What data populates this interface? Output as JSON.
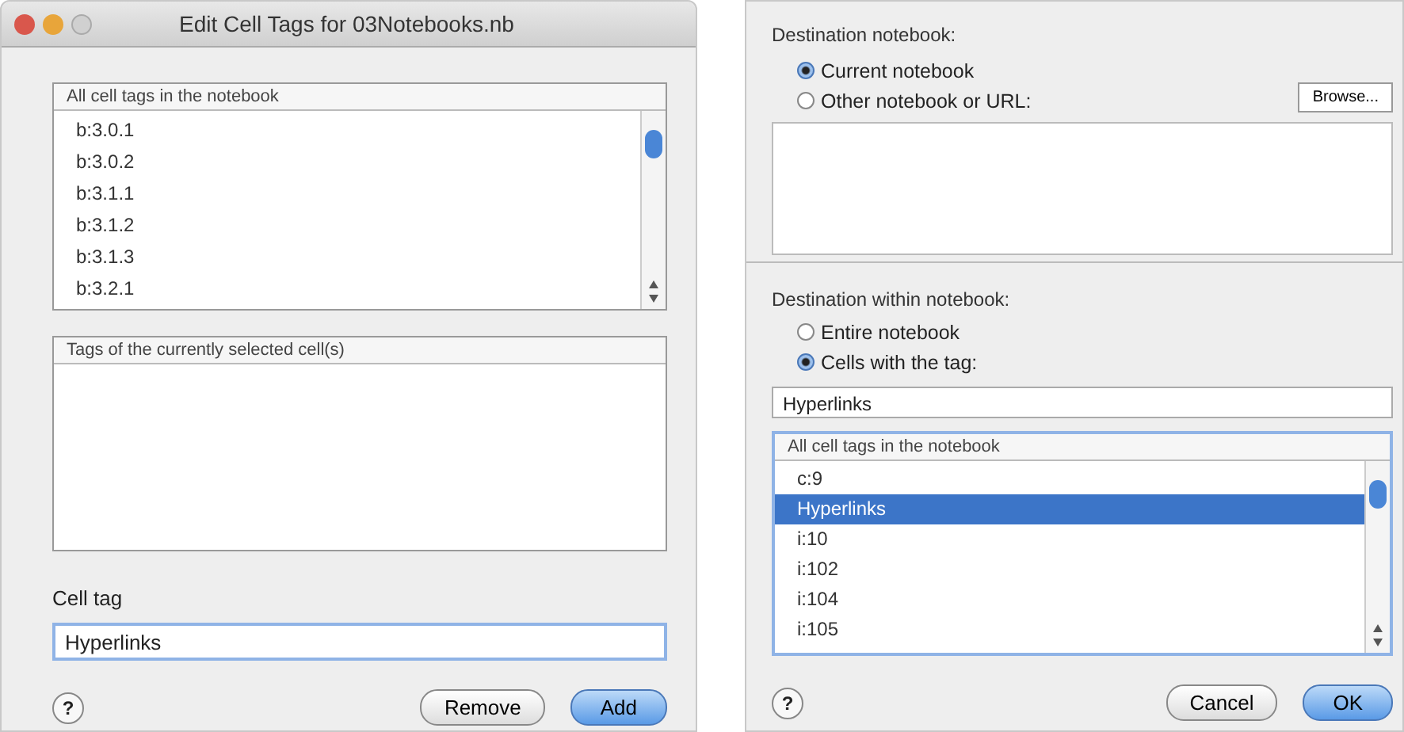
{
  "left_dialog": {
    "window": {
      "title": "Edit Cell Tags for 03Notebooks.nb"
    },
    "all_tags": {
      "header": "All cell tags in the notebook",
      "rows": [
        {
          "label": "b:3.0.1",
          "selected": false
        },
        {
          "label": "b:3.0.2",
          "selected": false
        },
        {
          "label": "b:3.1.1",
          "selected": false
        },
        {
          "label": "b:3.1.2",
          "selected": false
        },
        {
          "label": "b:3.1.3",
          "selected": false
        },
        {
          "label": "b:3.2.1",
          "selected": false
        }
      ]
    },
    "selected_tags": {
      "header": "Tags of the currently selected cell(s)"
    },
    "cell_tag": {
      "label": "Cell tag",
      "value": "Hyperlinks"
    },
    "help": "?",
    "buttons": [
      {
        "label": "Remove",
        "default": false
      },
      {
        "label": "Add",
        "default": true
      }
    ]
  },
  "right_dialog": {
    "destination_notebook": {
      "label": "Destination notebook:",
      "options": [
        {
          "label": "Current notebook",
          "selected": true
        },
        {
          "label": "Other notebook or URL:",
          "selected": false
        }
      ],
      "browse": "Browse..."
    },
    "destination_within": {
      "label": "Destination within notebook:",
      "options": [
        {
          "label": "Entire notebook",
          "selected": false
        },
        {
          "label": "Cells with the tag:",
          "selected": true
        }
      ],
      "tag_value": "Hyperlinks"
    },
    "all_tags": {
      "header": "All cell tags in the notebook",
      "rows": [
        {
          "label": "c:9",
          "selected": false
        },
        {
          "label": "Hyperlinks",
          "selected": true
        },
        {
          "label": "i:10",
          "selected": false
        },
        {
          "label": "i:102",
          "selected": false
        },
        {
          "label": "i:104",
          "selected": false
        },
        {
          "label": "i:105",
          "selected": false
        }
      ]
    },
    "help": "?",
    "buttons": [
      {
        "label": "Cancel",
        "default": false
      },
      {
        "label": "OK",
        "default": true
      }
    ]
  }
}
